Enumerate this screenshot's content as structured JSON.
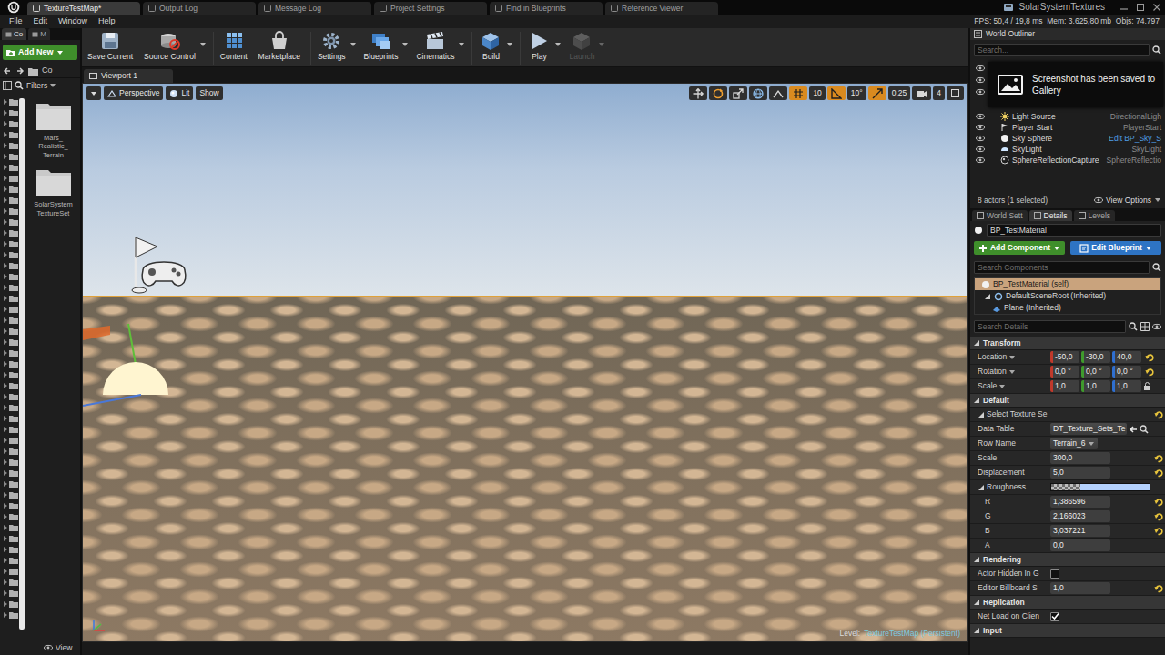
{
  "title_bar": {
    "tabs": [
      {
        "label": "TextureTestMap*",
        "selected": true
      },
      {
        "label": "Output Log",
        "selected": false
      },
      {
        "label": "Message Log",
        "selected": false
      },
      {
        "label": "Project Settings",
        "selected": false
      },
      {
        "label": "Find in Blueprints",
        "selected": false
      },
      {
        "label": "Reference Viewer",
        "selected": false
      }
    ],
    "project": "SolarSystemTextures"
  },
  "menu": [
    "File",
    "Edit",
    "Window",
    "Help"
  ],
  "stats": "FPS: 50,4 / 19,8 ms  Mem: 3.625,80 mb  Objs: 74.797",
  "content_browser": {
    "tabs": [
      {
        "label": "Co",
        "selected": true
      },
      {
        "label": "M",
        "selected": false
      }
    ],
    "add_new": "Add New",
    "path": "Co",
    "filters": "Filters",
    "folders": [
      "Mars_ Realistic_ Terrain",
      "SolarSystem TextureSet"
    ],
    "view": "View"
  },
  "toolbar": [
    {
      "label": "Save Current",
      "dropdown": false,
      "disabled": false
    },
    {
      "label": "Source Control",
      "dropdown": true,
      "disabled": false
    },
    {
      "label": "Content",
      "dropdown": false,
      "disabled": false
    },
    {
      "label": "Marketplace",
      "dropdown": false,
      "disabled": false
    },
    {
      "label": "Settings",
      "dropdown": true,
      "disabled": false
    },
    {
      "label": "Blueprints",
      "dropdown": true,
      "disabled": false
    },
    {
      "label": "Cinematics",
      "dropdown": true,
      "disabled": false
    },
    {
      "label": "Build",
      "dropdown": true,
      "disabled": false
    },
    {
      "label": "Play",
      "dropdown": true,
      "disabled": false
    },
    {
      "label": "Launch",
      "dropdown": true,
      "disabled": true
    }
  ],
  "viewport": {
    "tab": "Viewport 1",
    "view_mode": "Perspective",
    "lighting": "Lit",
    "show": "Show",
    "transform_modes": [
      {
        "selected": false
      },
      {
        "selected": true
      },
      {
        "selected": false
      }
    ],
    "snaps": [
      {
        "value": "10",
        "enabled": true
      },
      {
        "value": "10°",
        "enabled": true
      },
      {
        "value": "0,25",
        "enabled": true
      }
    ],
    "camera_speed": "4",
    "level_label": "Level:",
    "level_name": "TextureTestMap (Persistent)"
  },
  "outliner": {
    "title": "World Outliner",
    "search_placeholder": "Search...",
    "notification": "Screenshot has been saved to Gallery",
    "rows": [
      {
        "label": "Light Source",
        "type": "DirectionalLigh",
        "link": false,
        "visible": true
      },
      {
        "label": "Player Start",
        "type": "PlayerStart",
        "link": false,
        "visible": true
      },
      {
        "label": "Sky Sphere",
        "type": "Edit BP_Sky_S",
        "link": true,
        "visible": true
      },
      {
        "label": "SkyLight",
        "type": "SkyLight",
        "link": false,
        "visible": true
      },
      {
        "label": "SphereReflectionCapture",
        "type": "SphereReflectio",
        "link": false,
        "visible": true
      }
    ],
    "footer": "8 actors (1 selected)",
    "view_options": "View Options"
  },
  "details": {
    "tabs": [
      {
        "label": "World Sett",
        "selected": false
      },
      {
        "label": "Details",
        "selected": true
      },
      {
        "label": "Levels",
        "selected": false
      }
    ],
    "name": "BP_TestMaterial",
    "add_component": "Add Component",
    "edit_blueprint": "Edit Blueprint",
    "search_components": "Search Components",
    "components": [
      {
        "label": "BP_TestMaterial (self)",
        "selected": true,
        "expanded": false
      },
      {
        "label": "DefaultSceneRoot (Inherited)",
        "selected": false,
        "expanded": true
      },
      {
        "label": "Plane (Inherited)",
        "selected": false,
        "expanded": false
      }
    ],
    "search_details": "Search Details",
    "sections": [
      {
        "title": "Transform",
        "expanded": true,
        "rows": [
          {
            "kind": "vector",
            "label": "Location",
            "values": [
              "-50,0",
              "-30,0",
              "40,0"
            ],
            "reset": true
          },
          {
            "kind": "vector",
            "label": "Rotation",
            "values": [
              "0,0 °",
              "0,0 °",
              "0,0 °"
            ],
            "reset": true
          },
          {
            "kind": "vector",
            "label": "Scale",
            "values": [
              "1,0",
              "1,0",
              "1,0"
            ],
            "reset": false,
            "locked": false
          }
        ]
      },
      {
        "title": "Default",
        "expanded": true,
        "rows": [
          {
            "kind": "group",
            "label": "Select Texture Se",
            "expanded": true,
            "reset": true
          },
          {
            "kind": "asset",
            "label": "Data Table",
            "value": "DT_Texture_Sets_Te",
            "reset": false
          },
          {
            "kind": "combo",
            "label": "Row Name",
            "value": "Terrain_6",
            "reset": false
          },
          {
            "kind": "number",
            "label": "Scale",
            "value": "300,0",
            "reset": true
          },
          {
            "kind": "number",
            "label": "Displacement",
            "value": "5,0",
            "reset": true
          },
          {
            "kind": "color",
            "label": "Roughness",
            "expanded": true,
            "color": "#b4d2ff",
            "reset": false
          },
          {
            "kind": "channel",
            "label": "R",
            "value": "1,386596",
            "reset": true
          },
          {
            "kind": "channel",
            "label": "G",
            "value": "2,166023",
            "reset": true
          },
          {
            "kind": "channel",
            "label": "B",
            "value": "3,037221",
            "reset": true
          },
          {
            "kind": "channel",
            "label": "A",
            "value": "0,0",
            "reset": false
          }
        ]
      },
      {
        "title": "Rendering",
        "expanded": true,
        "rows": [
          {
            "kind": "check",
            "label": "Actor Hidden In G",
            "checked": false,
            "reset": false
          },
          {
            "kind": "number",
            "label": "Editor Billboard S",
            "value": "1,0",
            "reset": true
          }
        ]
      },
      {
        "title": "Replication",
        "expanded": true,
        "rows": [
          {
            "kind": "check",
            "label": "Net Load on Clien",
            "checked": true,
            "reset": false
          }
        ]
      },
      {
        "title": "Input",
        "expanded": true,
        "rows": []
      }
    ]
  }
}
